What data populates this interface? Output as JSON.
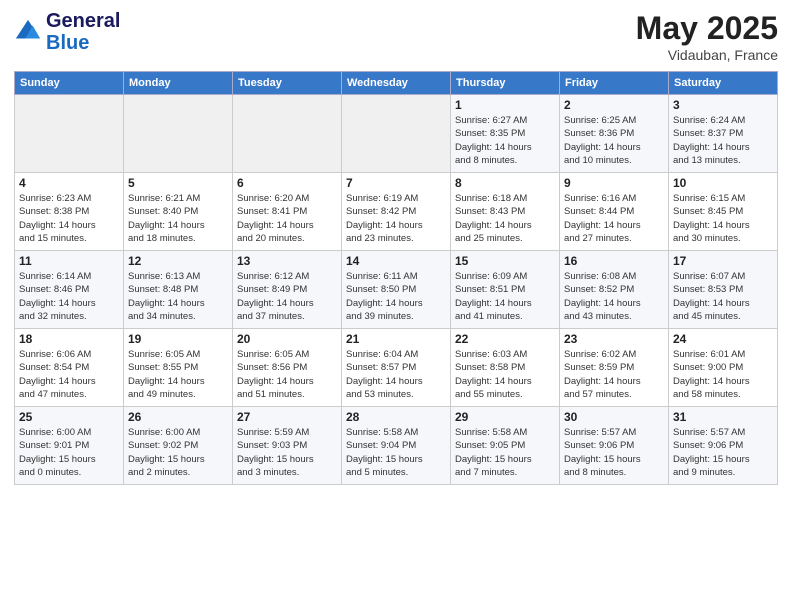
{
  "header": {
    "logo_line1": "General",
    "logo_line2": "Blue",
    "month": "May 2025",
    "location": "Vidauban, France"
  },
  "weekdays": [
    "Sunday",
    "Monday",
    "Tuesday",
    "Wednesday",
    "Thursday",
    "Friday",
    "Saturday"
  ],
  "weeks": [
    [
      {
        "day": "",
        "info": ""
      },
      {
        "day": "",
        "info": ""
      },
      {
        "day": "",
        "info": ""
      },
      {
        "day": "",
        "info": ""
      },
      {
        "day": "1",
        "info": "Sunrise: 6:27 AM\nSunset: 8:35 PM\nDaylight: 14 hours\nand 8 minutes."
      },
      {
        "day": "2",
        "info": "Sunrise: 6:25 AM\nSunset: 8:36 PM\nDaylight: 14 hours\nand 10 minutes."
      },
      {
        "day": "3",
        "info": "Sunrise: 6:24 AM\nSunset: 8:37 PM\nDaylight: 14 hours\nand 13 minutes."
      }
    ],
    [
      {
        "day": "4",
        "info": "Sunrise: 6:23 AM\nSunset: 8:38 PM\nDaylight: 14 hours\nand 15 minutes."
      },
      {
        "day": "5",
        "info": "Sunrise: 6:21 AM\nSunset: 8:40 PM\nDaylight: 14 hours\nand 18 minutes."
      },
      {
        "day": "6",
        "info": "Sunrise: 6:20 AM\nSunset: 8:41 PM\nDaylight: 14 hours\nand 20 minutes."
      },
      {
        "day": "7",
        "info": "Sunrise: 6:19 AM\nSunset: 8:42 PM\nDaylight: 14 hours\nand 23 minutes."
      },
      {
        "day": "8",
        "info": "Sunrise: 6:18 AM\nSunset: 8:43 PM\nDaylight: 14 hours\nand 25 minutes."
      },
      {
        "day": "9",
        "info": "Sunrise: 6:16 AM\nSunset: 8:44 PM\nDaylight: 14 hours\nand 27 minutes."
      },
      {
        "day": "10",
        "info": "Sunrise: 6:15 AM\nSunset: 8:45 PM\nDaylight: 14 hours\nand 30 minutes."
      }
    ],
    [
      {
        "day": "11",
        "info": "Sunrise: 6:14 AM\nSunset: 8:46 PM\nDaylight: 14 hours\nand 32 minutes."
      },
      {
        "day": "12",
        "info": "Sunrise: 6:13 AM\nSunset: 8:48 PM\nDaylight: 14 hours\nand 34 minutes."
      },
      {
        "day": "13",
        "info": "Sunrise: 6:12 AM\nSunset: 8:49 PM\nDaylight: 14 hours\nand 37 minutes."
      },
      {
        "day": "14",
        "info": "Sunrise: 6:11 AM\nSunset: 8:50 PM\nDaylight: 14 hours\nand 39 minutes."
      },
      {
        "day": "15",
        "info": "Sunrise: 6:09 AM\nSunset: 8:51 PM\nDaylight: 14 hours\nand 41 minutes."
      },
      {
        "day": "16",
        "info": "Sunrise: 6:08 AM\nSunset: 8:52 PM\nDaylight: 14 hours\nand 43 minutes."
      },
      {
        "day": "17",
        "info": "Sunrise: 6:07 AM\nSunset: 8:53 PM\nDaylight: 14 hours\nand 45 minutes."
      }
    ],
    [
      {
        "day": "18",
        "info": "Sunrise: 6:06 AM\nSunset: 8:54 PM\nDaylight: 14 hours\nand 47 minutes."
      },
      {
        "day": "19",
        "info": "Sunrise: 6:05 AM\nSunset: 8:55 PM\nDaylight: 14 hours\nand 49 minutes."
      },
      {
        "day": "20",
        "info": "Sunrise: 6:05 AM\nSunset: 8:56 PM\nDaylight: 14 hours\nand 51 minutes."
      },
      {
        "day": "21",
        "info": "Sunrise: 6:04 AM\nSunset: 8:57 PM\nDaylight: 14 hours\nand 53 minutes."
      },
      {
        "day": "22",
        "info": "Sunrise: 6:03 AM\nSunset: 8:58 PM\nDaylight: 14 hours\nand 55 minutes."
      },
      {
        "day": "23",
        "info": "Sunrise: 6:02 AM\nSunset: 8:59 PM\nDaylight: 14 hours\nand 57 minutes."
      },
      {
        "day": "24",
        "info": "Sunrise: 6:01 AM\nSunset: 9:00 PM\nDaylight: 14 hours\nand 58 minutes."
      }
    ],
    [
      {
        "day": "25",
        "info": "Sunrise: 6:00 AM\nSunset: 9:01 PM\nDaylight: 15 hours\nand 0 minutes."
      },
      {
        "day": "26",
        "info": "Sunrise: 6:00 AM\nSunset: 9:02 PM\nDaylight: 15 hours\nand 2 minutes."
      },
      {
        "day": "27",
        "info": "Sunrise: 5:59 AM\nSunset: 9:03 PM\nDaylight: 15 hours\nand 3 minutes."
      },
      {
        "day": "28",
        "info": "Sunrise: 5:58 AM\nSunset: 9:04 PM\nDaylight: 15 hours\nand 5 minutes."
      },
      {
        "day": "29",
        "info": "Sunrise: 5:58 AM\nSunset: 9:05 PM\nDaylight: 15 hours\nand 7 minutes."
      },
      {
        "day": "30",
        "info": "Sunrise: 5:57 AM\nSunset: 9:06 PM\nDaylight: 15 hours\nand 8 minutes."
      },
      {
        "day": "31",
        "info": "Sunrise: 5:57 AM\nSunset: 9:06 PM\nDaylight: 15 hours\nand 9 minutes."
      }
    ]
  ]
}
